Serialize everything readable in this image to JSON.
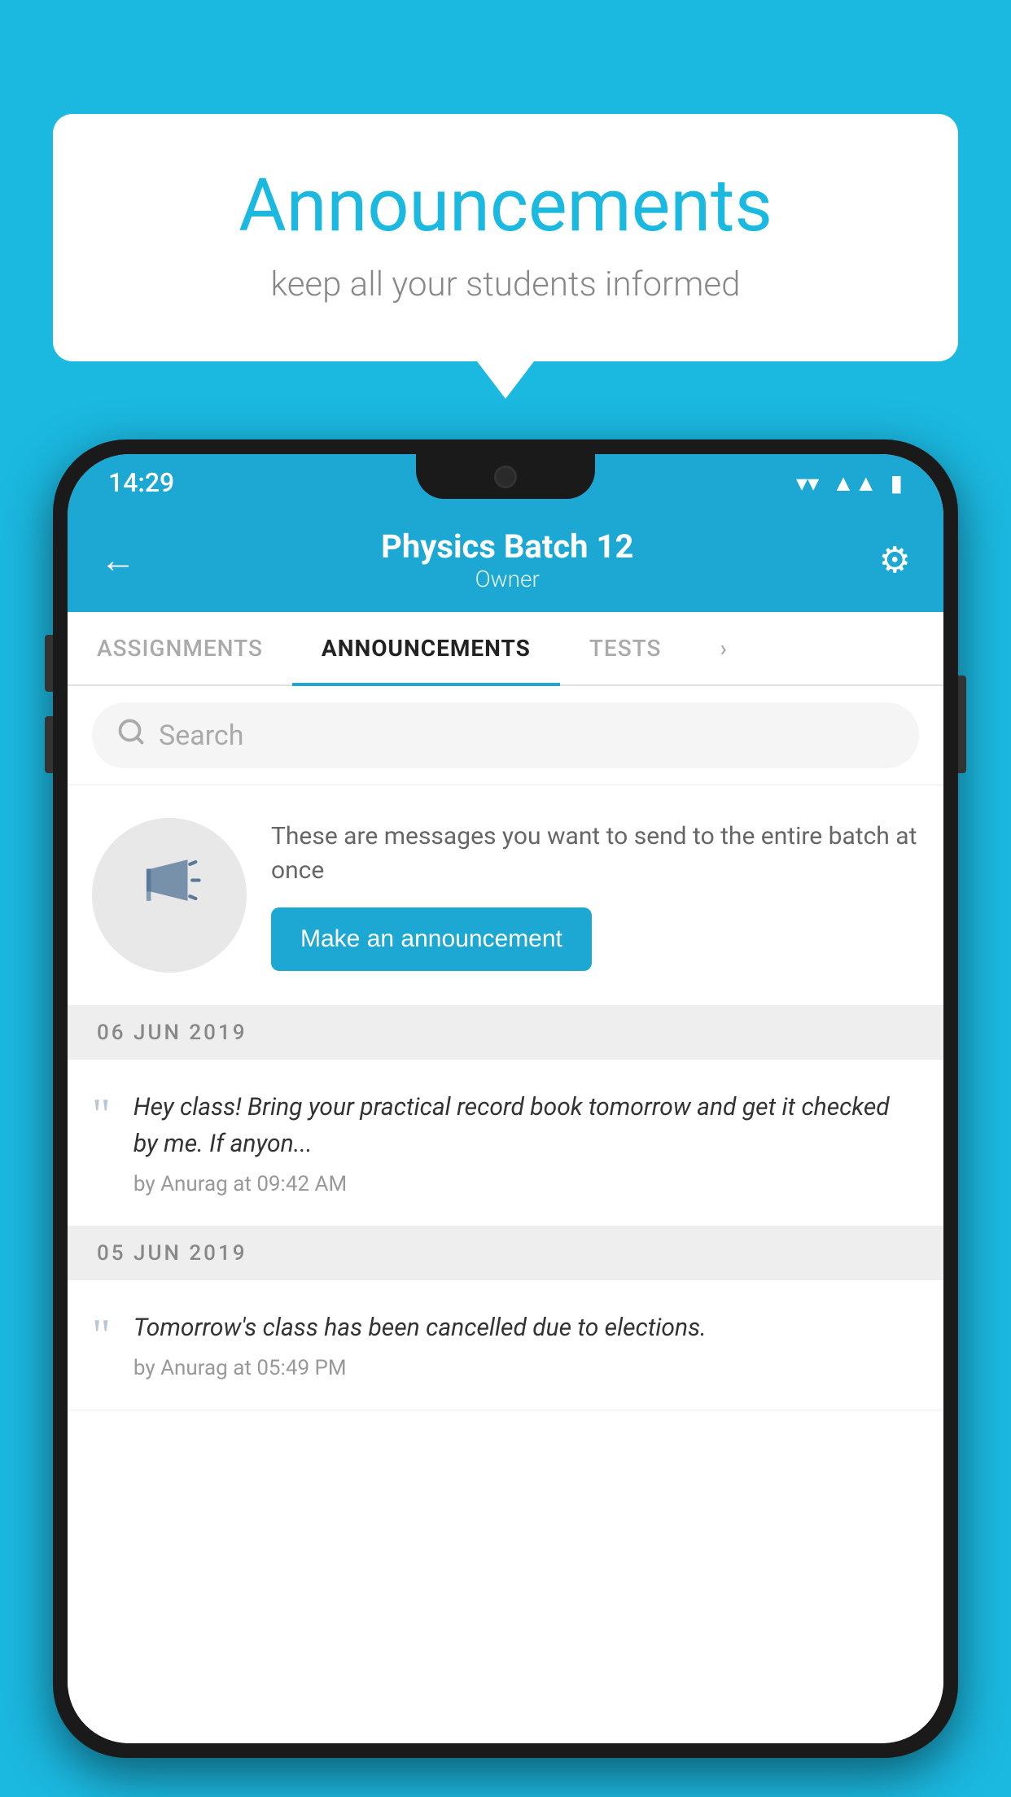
{
  "background_color": "#1bb8e0",
  "speech_bubble": {
    "title": "Announcements",
    "subtitle": "keep all your students informed"
  },
  "phone": {
    "status_bar": {
      "time": "14:29",
      "wifi": "▾",
      "signal": "▲",
      "battery": "▮"
    },
    "header": {
      "back_icon": "←",
      "title": "Physics Batch 12",
      "subtitle": "Owner",
      "gear_icon": "⚙"
    },
    "tabs": [
      {
        "label": "ASSIGNMENTS",
        "active": false
      },
      {
        "label": "ANNOUNCEMENTS",
        "active": true
      },
      {
        "label": "TESTS",
        "active": false
      },
      {
        "label": "...",
        "active": false
      }
    ],
    "search": {
      "placeholder": "Search",
      "icon": "🔍"
    },
    "announcement_prompt": {
      "description": "These are messages you want to send to the entire batch at once",
      "button_label": "Make an announcement"
    },
    "messages": [
      {
        "date": "06  JUN  2019",
        "text": "Hey class! Bring your practical record book tomorrow and get it checked by me. If anyon...",
        "author": "by Anurag at 09:42 AM"
      },
      {
        "date": "05  JUN  2019",
        "text": "Tomorrow's class has been cancelled due to elections.",
        "author": "by Anurag at 05:49 PM"
      }
    ]
  }
}
